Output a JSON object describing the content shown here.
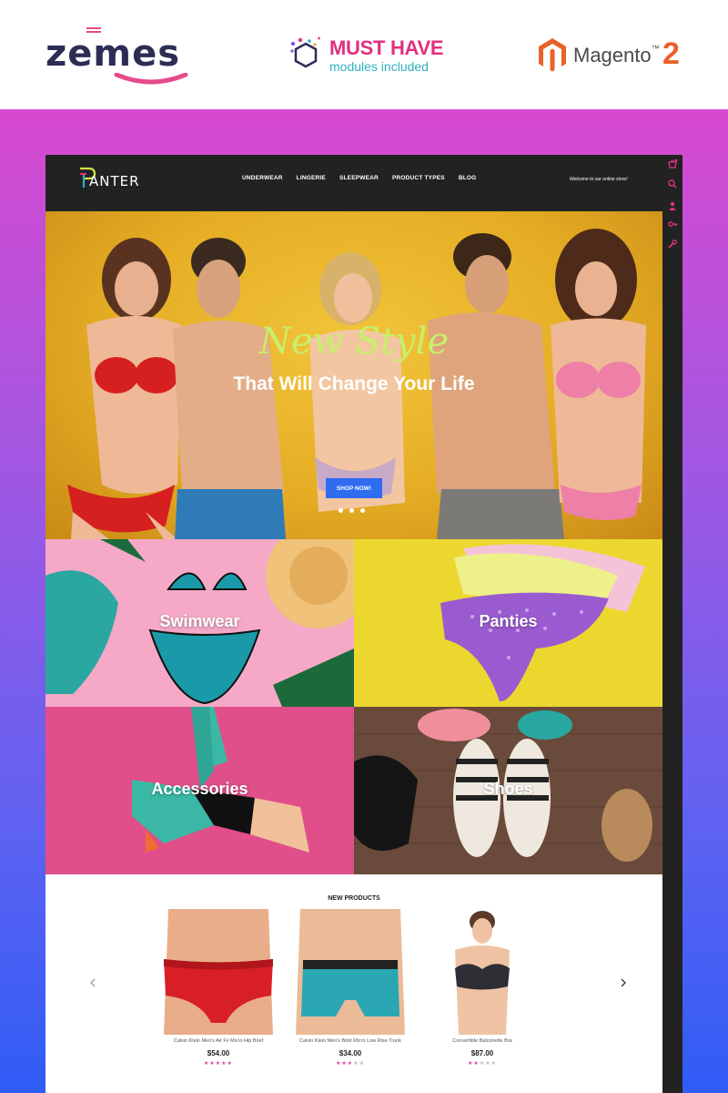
{
  "promo": {
    "zemes": "zemes",
    "must_have_title": "MUST HAVE",
    "must_have_sub": "modules included",
    "magento": "Magento",
    "magento_tm": "™",
    "magento_version": "2"
  },
  "header": {
    "logo": "ANTER",
    "nav": [
      "UNDERWEAR",
      "LINGERIE",
      "SLEEPWEAR",
      "PRODUCT TYPES",
      "BLOG"
    ],
    "welcome": "Welcome to our online store!"
  },
  "hero": {
    "title": "New Style",
    "subtitle": "That Will Change Your Life",
    "button": "SHOP NOW!"
  },
  "categories": [
    "Swimwear",
    "Panties",
    "Accessories",
    "Shoes"
  ],
  "new_products": {
    "title": "NEW PRODUCTS",
    "items": [
      {
        "name": "Calvin Klein Men's Air Fx Micro Hip Brief",
        "price": "$54.00",
        "rating": 5
      },
      {
        "name": "Calvin Klein Men's Bold Micro Low Rise Trunk",
        "price": "$34.00",
        "rating": 3
      },
      {
        "name": "Convertible Balconette Bra",
        "price": "$87.00",
        "rating": 2
      }
    ]
  },
  "colors": {
    "accent_blue": "#2f6cf0",
    "header_bg": "#222223",
    "brand_pink": "#e1307e",
    "hero_yellow": "#e5ad24"
  }
}
